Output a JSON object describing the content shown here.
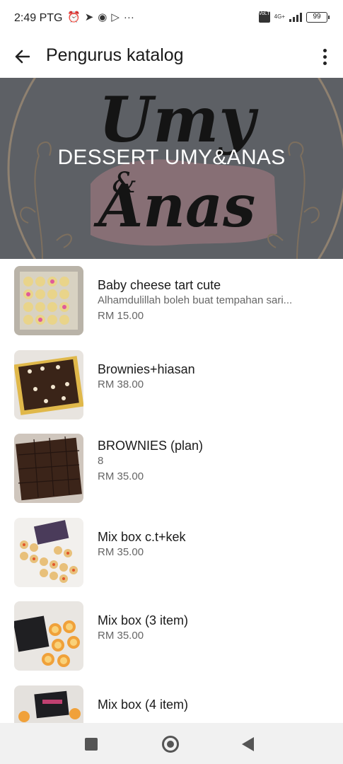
{
  "status_bar": {
    "time": "2:49 PTG",
    "icons": [
      "alarm-icon",
      "telegram-icon",
      "messenger-icon",
      "play-icon",
      "more-notifications-icon"
    ],
    "sim_label": "VoLTE",
    "network_label": "4G+",
    "battery": "99"
  },
  "header": {
    "title": "Pengurus katalog",
    "back_icon": "arrow-left-icon",
    "menu_icon": "more-vertical-icon"
  },
  "banner": {
    "title": "DESSERT UMY&ANAS",
    "logo_text_top": "Umy",
    "logo_text_mid": "&",
    "logo_text_bottom": "Anas",
    "colors": {
      "overlay": "#5a5d62",
      "brush": "#c9a4ad",
      "script": "#111111",
      "ring": "#c8a47a"
    }
  },
  "products": [
    {
      "name": "Baby cheese tart cute",
      "description": "Alhamdulillah boleh buat tempahan sari...",
      "price": "RM 15.00",
      "thumb": "cheese-tart-tray"
    },
    {
      "name": "Brownies+hiasan",
      "description": "",
      "price": "RM 38.00",
      "thumb": "decorated-brownies"
    },
    {
      "name": "BROWNIES (plan)",
      "description": "8",
      "price": "RM 35.00",
      "thumb": "plain-brownies"
    },
    {
      "name": "Mix box c.t+kek",
      "description": "",
      "price": "RM 35.00",
      "thumb": "mix-box-tarts-cake"
    },
    {
      "name": "Mix box (3 item)",
      "description": "",
      "price": "RM 35.00",
      "thumb": "mix-box-three"
    },
    {
      "name": "Mix box (4 item)",
      "description": "",
      "price": "",
      "thumb": "mix-box-four"
    }
  ],
  "nav_bar": {
    "recents_icon": "square-icon",
    "home_icon": "circle-home-icon",
    "back_icon": "triangle-back-icon"
  }
}
